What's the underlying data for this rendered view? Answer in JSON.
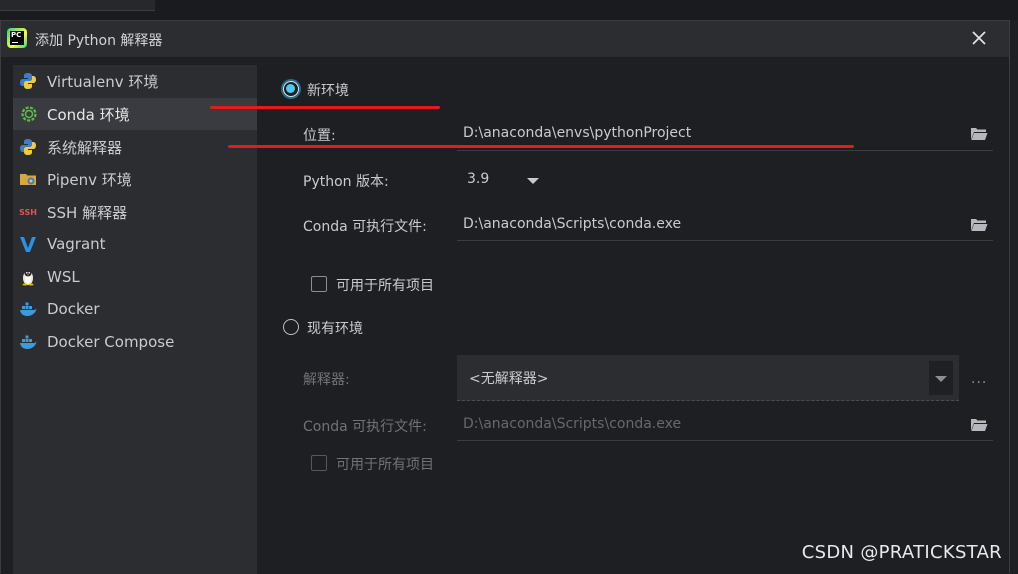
{
  "window": {
    "title": "添加 Python 解释器"
  },
  "sidebar": {
    "items": [
      {
        "label": "Virtualenv 环境",
        "icon": "python-icon"
      },
      {
        "label": "Conda 环境",
        "icon": "conda-icon",
        "selected": true
      },
      {
        "label": "系统解释器",
        "icon": "python-icon"
      },
      {
        "label": "Pipenv 环境",
        "icon": "pipenv-folder-icon"
      },
      {
        "label": "SSH 解释器",
        "icon": "ssh-icon",
        "icon_text": "SSH"
      },
      {
        "label": "Vagrant",
        "icon": "vagrant-icon"
      },
      {
        "label": "WSL",
        "icon": "linux-tux-icon"
      },
      {
        "label": "Docker",
        "icon": "docker-icon"
      },
      {
        "label": "Docker Compose",
        "icon": "docker-icon"
      }
    ]
  },
  "new_env": {
    "label": "新环境",
    "selected": true,
    "location_label": "位置:",
    "location_value": "D:\\anaconda\\envs\\pythonProject",
    "python_version_label": "Python 版本:",
    "python_version_value": "3.9",
    "conda_exe_label": "Conda 可执行文件:",
    "conda_exe_value": "D:\\anaconda\\Scripts\\conda.exe",
    "available_all_label": "可用于所有项目",
    "available_all_checked": false
  },
  "existing_env": {
    "label": "现有环境",
    "selected": false,
    "interpreter_label": "解释器:",
    "interpreter_value": "<无解释器>",
    "more_label": "...",
    "conda_exe_label": "Conda 可执行文件:",
    "conda_exe_value": "D:\\anaconda\\Scripts\\conda.exe",
    "available_all_label": "可用于所有项目",
    "available_all_checked": false
  },
  "colors": {
    "accent": "#4cc7ee",
    "annotation_red": "#e21b1b",
    "background": "#1e1f22",
    "sidebar_bg": "#2b2d30"
  },
  "watermark": "CSDN @PRATICKSTAR"
}
